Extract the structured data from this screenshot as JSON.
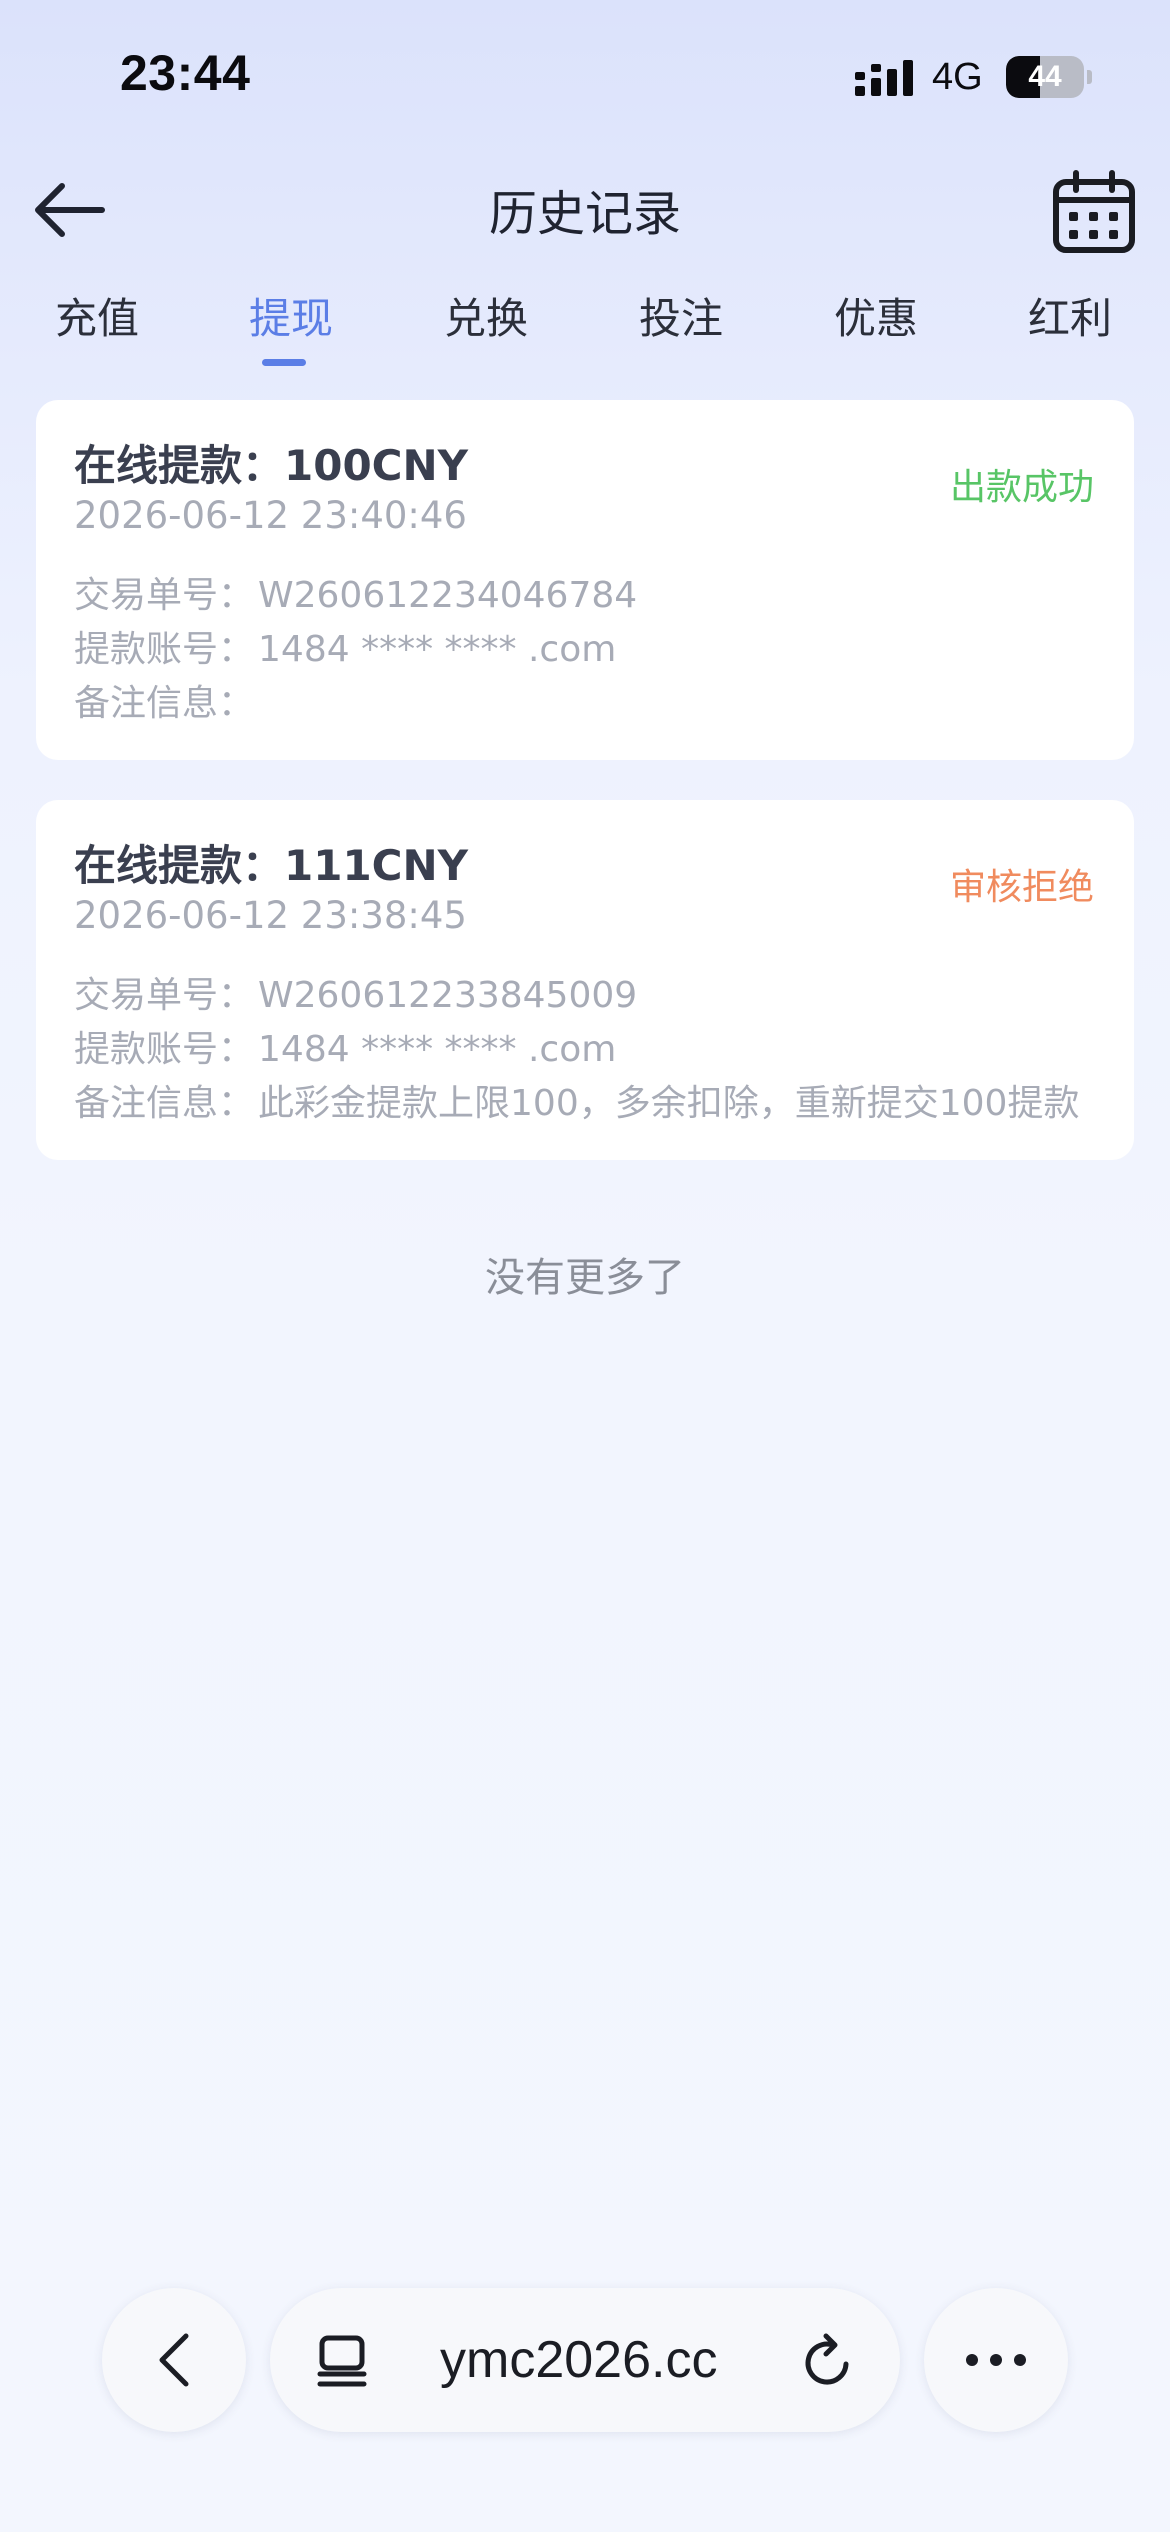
{
  "status_bar": {
    "time": "23:44",
    "network": "4G",
    "battery": "44",
    "battery_level_percent": 44,
    "icons": [
      "signal-icon",
      "battery-icon"
    ]
  },
  "header": {
    "title": "历史记录",
    "icons": [
      "back-arrow-icon",
      "calendar-icon"
    ]
  },
  "tabs": [
    {
      "label": "充值",
      "active": false
    },
    {
      "label": "提现",
      "active": true
    },
    {
      "label": "兑换",
      "active": false
    },
    {
      "label": "投注",
      "active": false
    },
    {
      "label": "优惠",
      "active": false
    },
    {
      "label": "红利",
      "active": false
    }
  ],
  "records": [
    {
      "title": "在线提款：100CNY",
      "date": "2026-06-12 23:40:46",
      "status": "出款成功",
      "status_color": "#58c566",
      "order_label": "交易单号：",
      "order_value": "W260612234046784",
      "account_label": "提款账号：",
      "account_value": "1484 **** **** .com",
      "note_label": "备注信息：",
      "note_value": ""
    },
    {
      "title": "在线提款：111CNY",
      "date": "2026-06-12 23:38:45",
      "status": "审核拒绝",
      "status_color": "#f08b5e",
      "order_label": "交易单号：",
      "order_value": "W260612233845009",
      "account_label": "提款账号：",
      "account_value": "1484 **** **** .com",
      "note_label": "备注信息：",
      "note_value": "此彩金提款上限100，多余扣除，重新提交100提款"
    }
  ],
  "list_footer": "没有更多了",
  "browser": {
    "url": "ymc2026.cc",
    "icons": [
      "back-chevron-icon",
      "tabs-icon",
      "reload-icon",
      "more-icon"
    ]
  },
  "colors": {
    "accent": "#5b7ee6",
    "success": "#58c566",
    "rejected": "#f08b5e"
  }
}
